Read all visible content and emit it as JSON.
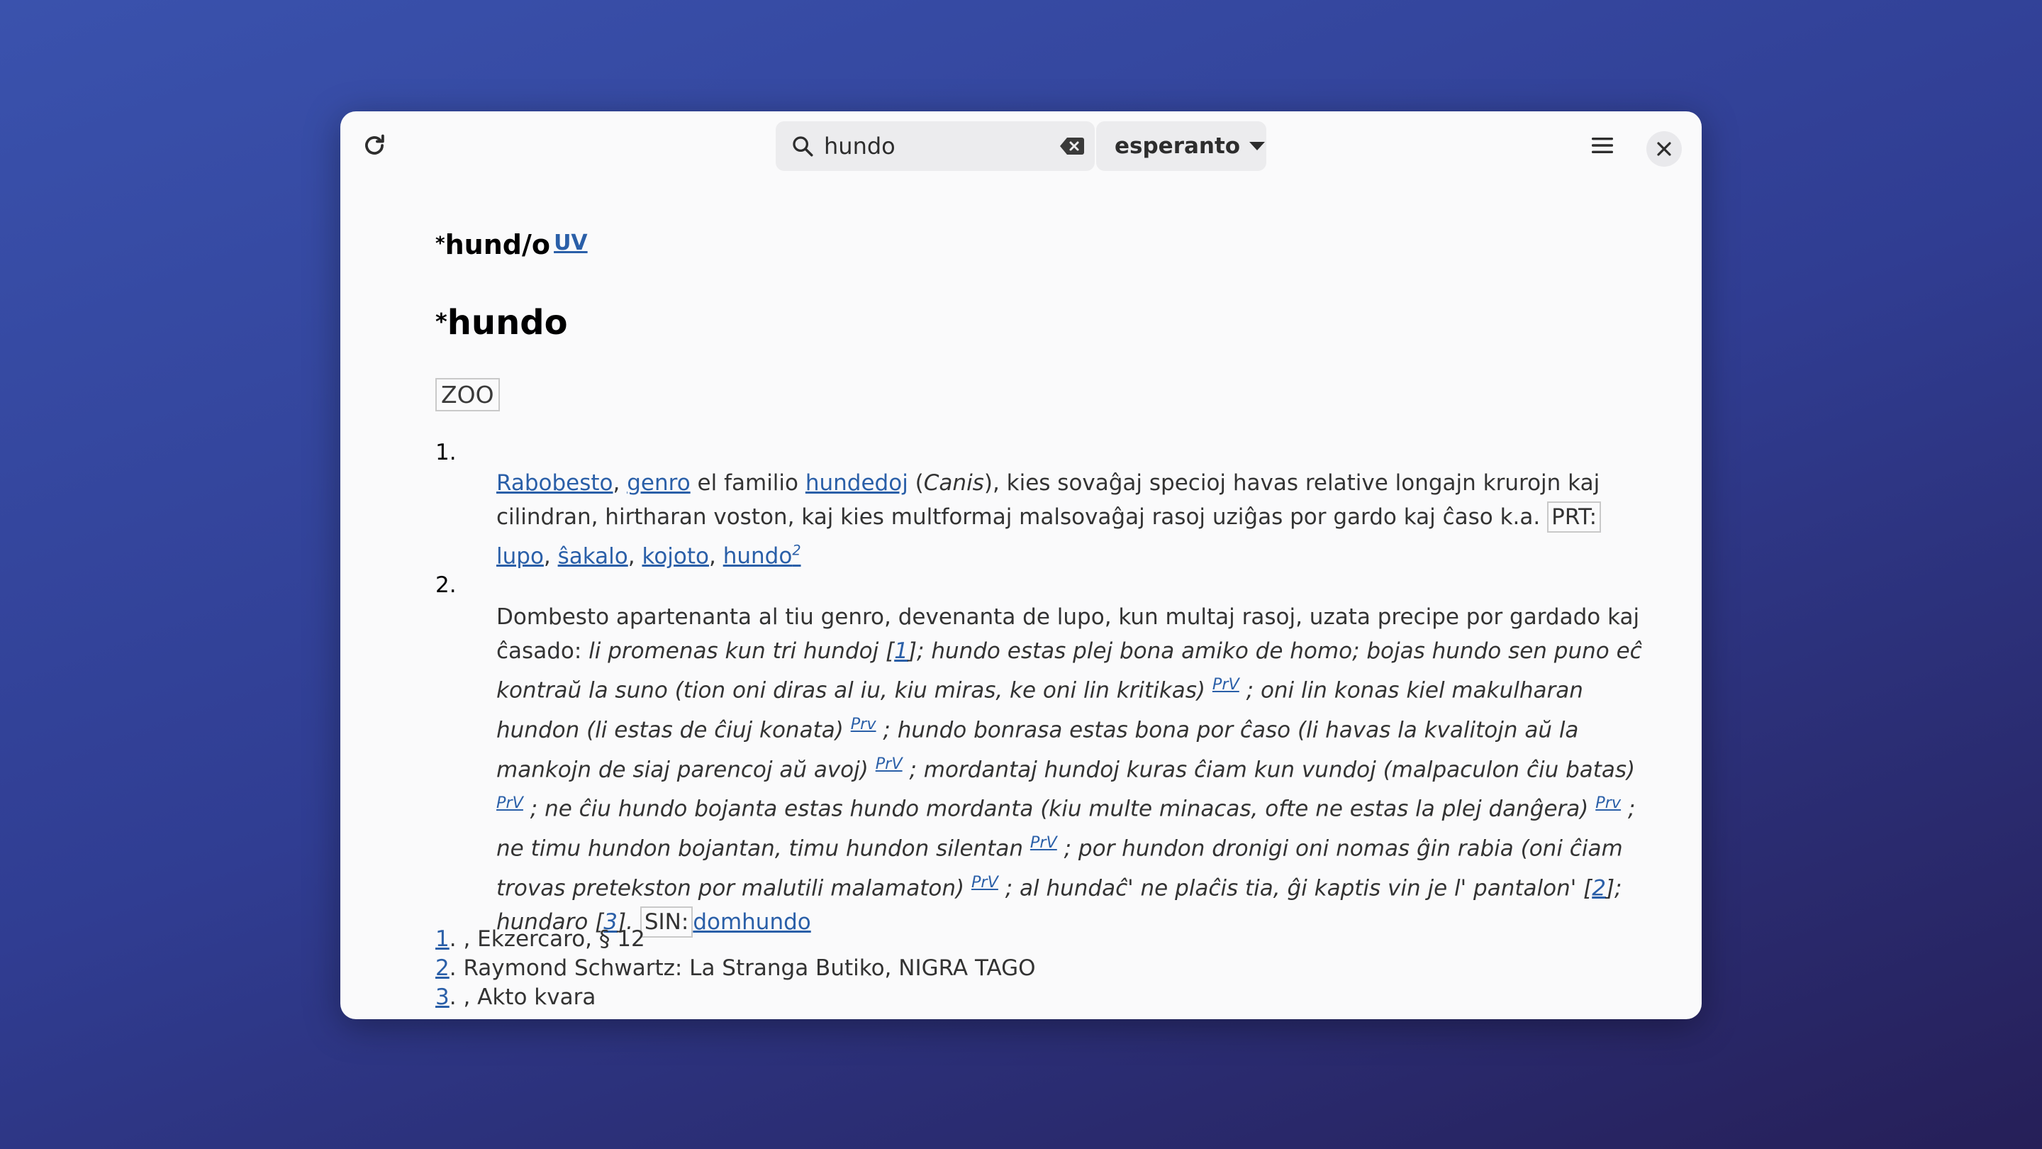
{
  "search": {
    "query": "hundo",
    "placeholder": ""
  },
  "language": {
    "selected": "esperanto"
  },
  "entry": {
    "headword_root": "hund/o",
    "headword_prefix": "*",
    "source_link": "UV",
    "derived_word": "hundo",
    "domain_badge": "ZOO"
  },
  "sense1": {
    "number": "1.",
    "link_rabobesto": "Rabobesto",
    "sep_comma": ",",
    "link_genro": "genro",
    "text_el_familio": "el familio",
    "link_hundedoj": "hundedoj",
    "open_paren": "(",
    "canis": "Canis",
    "text_desc": "), kies sovaĝaj specioj havas relative longajn krurojn kaj cilindran, hirtharan voston, kaj kies multformaj malsovaĝaj rasoj uziĝas por gardo kaj ĉaso k.a.",
    "tag_prt": "PRT:",
    "link_lupo": "lupo",
    "link_sakalo": "ŝakalo",
    "link_kojoto": "kojoto",
    "link_hundo": "hundo",
    "hundo_sup": "2"
  },
  "sense2": {
    "number": "2.",
    "text_intro": "Dombesto apartenanta al tiu genro, devenanta de lupo, kun multaj rasoj, uzata precipe por gardado kaj ĉasado:",
    "ex1": "li promenas kun tri hundoj",
    "ref1_open": "[",
    "ref1": "1",
    "ref1_close": "];",
    "ex2": "hundo estas plej bona amiko de homo; bojas hundo sen puno eĉ kontraŭ la suno (tion oni diras al iu, kiu miras, ke oni lin kritikas)",
    "prv1": "PrV",
    "ex3": "; oni lin konas kiel makulharan hundon (li estas de ĉiuj konata)",
    "prv2": "Prv",
    "ex4": "; hundo bonrasa estas bona por ĉaso (li havas la kvalitojn aŭ la mankojn de siaj parencoj aŭ avoj)",
    "prv3": "PrV",
    "ex5": "; mordantaj hundoj kuras ĉiam kun vundoj (malpaculon ĉiu batas)",
    "prv4": "PrV",
    "ex6": "; ne ĉiu hundo bojanta estas hundo mordanta (kiu multe minacas, ofte ne estas la plej danĝera)",
    "prv5": "Prv",
    "ex7": "; ne timu hundon bojantan, timu hundon silentan",
    "prv6": "PrV",
    "ex8": "; por hundon dronigi oni nomas ĝin rabia (oni ĉiam trovas pretekston por malutili malamaton)",
    "prv7": "PrV",
    "ex9": "; al hundaĉ' ne plaĉis tia, ĝi kaptis vin je l' pantalon'",
    "ref2_open": "[",
    "ref2": "2",
    "ref2_close": "];",
    "ex10": "hundaro",
    "ref3_open": "[",
    "ref3": "3",
    "ref3_close": "].",
    "tag_sin": "SIN:",
    "link_domhundo": "domhundo"
  },
  "references": [
    {
      "num": "1",
      "text": ". , Ekzercaro, § 12"
    },
    {
      "num": "2",
      "text": ". Raymond Schwartz: La Stranga Butiko, NIGRA TAGO"
    },
    {
      "num": "3",
      "text": ". , Akto kvara"
    }
  ],
  "colors": {
    "link": "#2a5fa8",
    "window_bg": "#fafafb",
    "accent_bg": "#3a52ad"
  }
}
